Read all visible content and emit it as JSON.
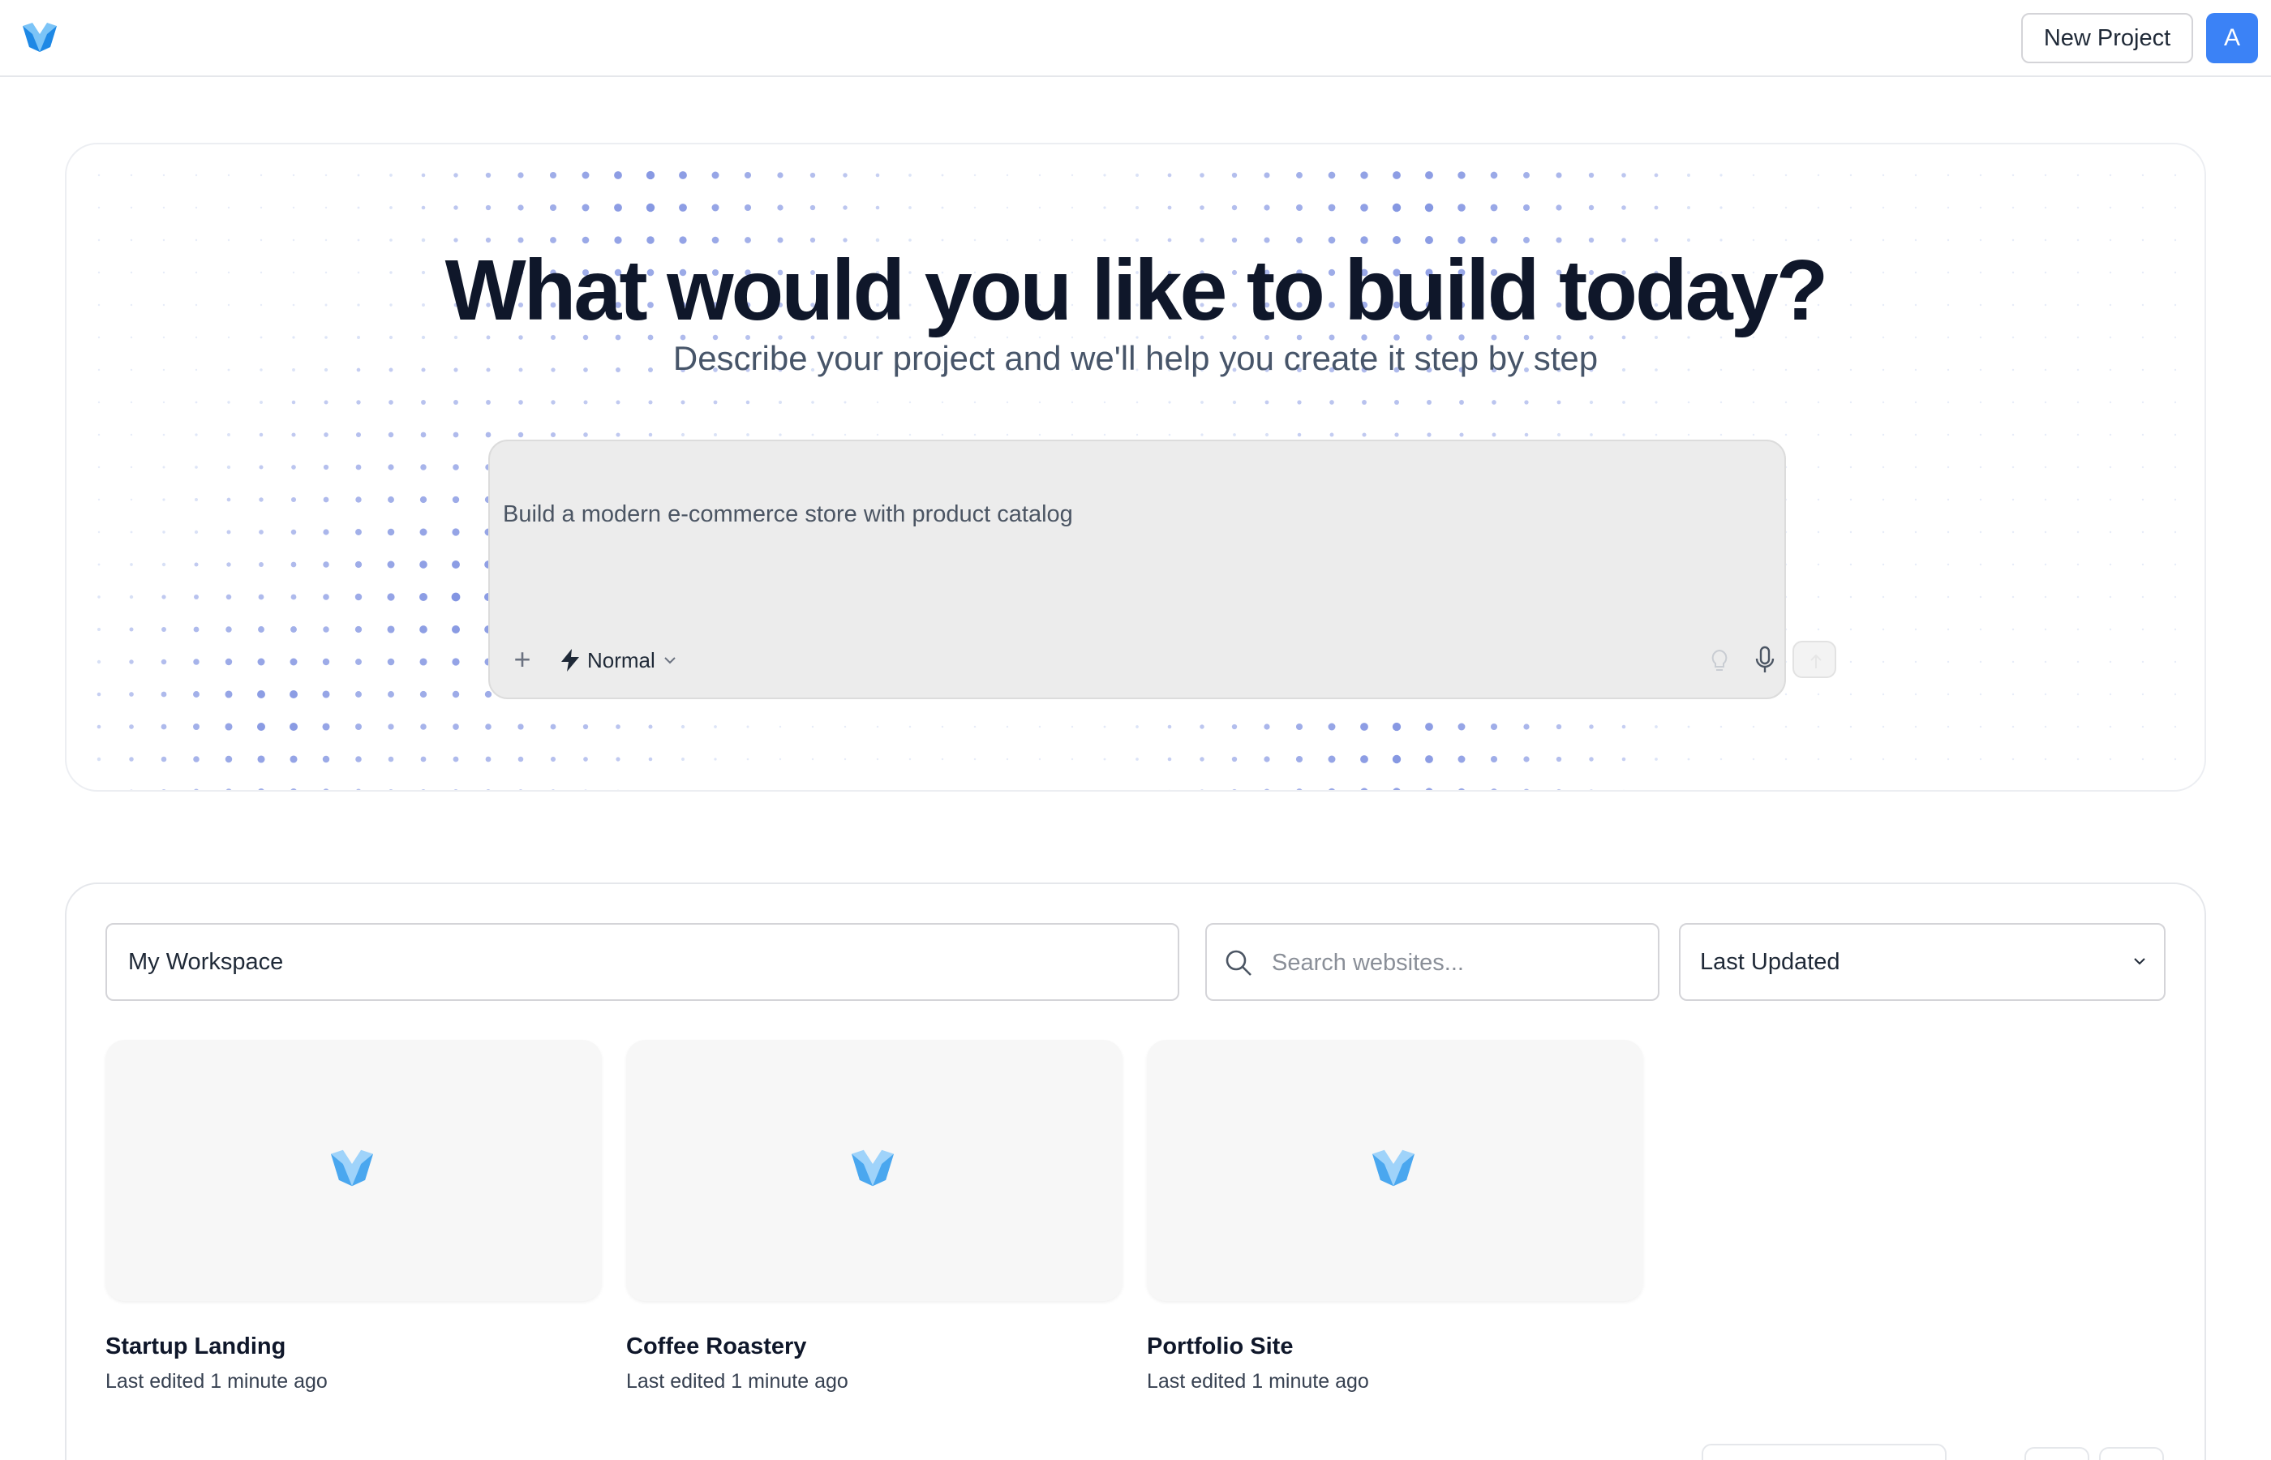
{
  "header": {
    "logo_icon": "brand-w-logo",
    "new_project_label": "New Project",
    "avatar_initial": "A"
  },
  "hero": {
    "title": "What would you like to build today?",
    "subtitle": "Describe your project and we'll help you create it step by step",
    "prompt": {
      "value": "Build a modern e-commerce store with product catalog",
      "add_icon": "plus-icon",
      "mode_label": "Normal",
      "mode_icon": "lightning-icon",
      "idea_icon": "lightbulb-icon",
      "mic_icon": "microphone-icon",
      "send_icon": "arrow-up-icon"
    }
  },
  "projects": {
    "workspace_label": "My Workspace",
    "search_placeholder": "Search websites...",
    "sort_label": "Last Updated",
    "items": [
      {
        "title": "Startup Landing",
        "meta": "Last edited 1 minute ago"
      },
      {
        "title": "Coffee Roastery",
        "meta": "Last edited 1 minute ago"
      },
      {
        "title": "Portfolio Site",
        "meta": "Last edited 1 minute ago"
      }
    ]
  },
  "colors": {
    "accent": "#3b82f6",
    "dots_blue": "#7c8fe0",
    "dots_light": "#9fb4e8",
    "logo_light": "#7cc4f7",
    "logo_dark": "#1e88e5"
  }
}
